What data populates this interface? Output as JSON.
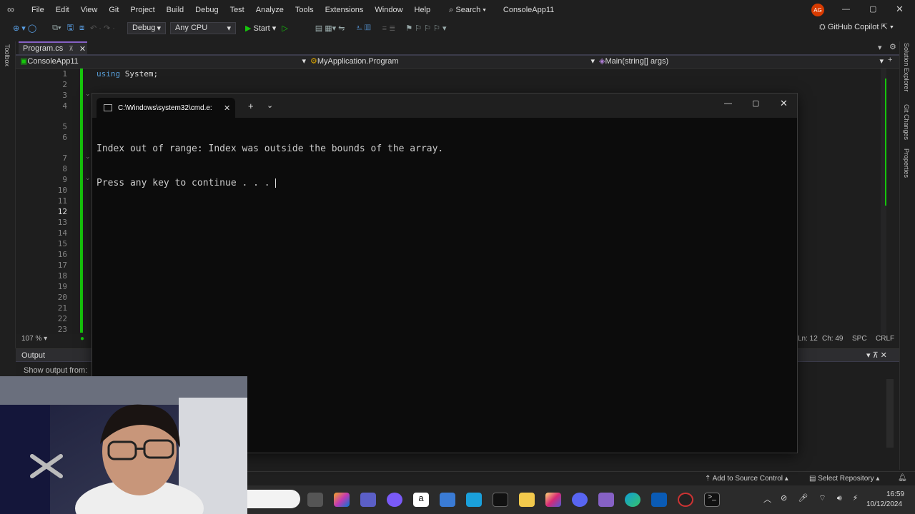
{
  "menubar": {
    "items": [
      "File",
      "Edit",
      "View",
      "Git",
      "Project",
      "Build",
      "Debug",
      "Test",
      "Analyze",
      "Tools",
      "Extensions",
      "Window",
      "Help"
    ],
    "search_label": "Search",
    "solution_name": "ConsoleApp11",
    "avatar_initials": "AG"
  },
  "toolbar": {
    "config": "Debug",
    "platform": "Any CPU",
    "start_label": "Start",
    "copilot_label": "GitHub Copilot"
  },
  "side_panels": {
    "left": "Toolbox",
    "right": [
      "Solution Explorer",
      "Git Changes",
      "Properties"
    ]
  },
  "editor": {
    "tab_name": "Program.cs",
    "nav_project": "ConsoleApp11",
    "nav_class": "MyApplication.Program",
    "nav_member": "Main(string[] args)",
    "line_numbers": [
      "1",
      "2",
      "3",
      "4",
      "5",
      "6",
      "7",
      "8",
      "9",
      "10",
      "11",
      "12",
      "13",
      "14",
      "15",
      "16",
      "17",
      "18",
      "19",
      "20",
      "21",
      "22",
      "23"
    ],
    "line1_code": "using System;",
    "zoom": "107 %",
    "status_ln": "Ln: 12",
    "status_ch": "Ch: 49",
    "status_spc": "SPC",
    "status_crlf": "CRLF"
  },
  "output_panel": {
    "title": "Output",
    "show_from_label": "Show output from:"
  },
  "terminal": {
    "tab_title": "C:\\Windows\\system32\\cmd.e:",
    "line1": "Index out of range: Index was outside the bounds of the array.",
    "line2": "Press any key to continue . . ."
  },
  "statusbar": {
    "source_control": "Add to Source Control",
    "repository": "Select Repository"
  },
  "taskbar": {
    "time": "16:59",
    "date": "10/12/2024"
  },
  "colors": {
    "accent_green": "#16c60c",
    "vs_purple": "#8661c5",
    "avatar_red": "#d83b01"
  }
}
